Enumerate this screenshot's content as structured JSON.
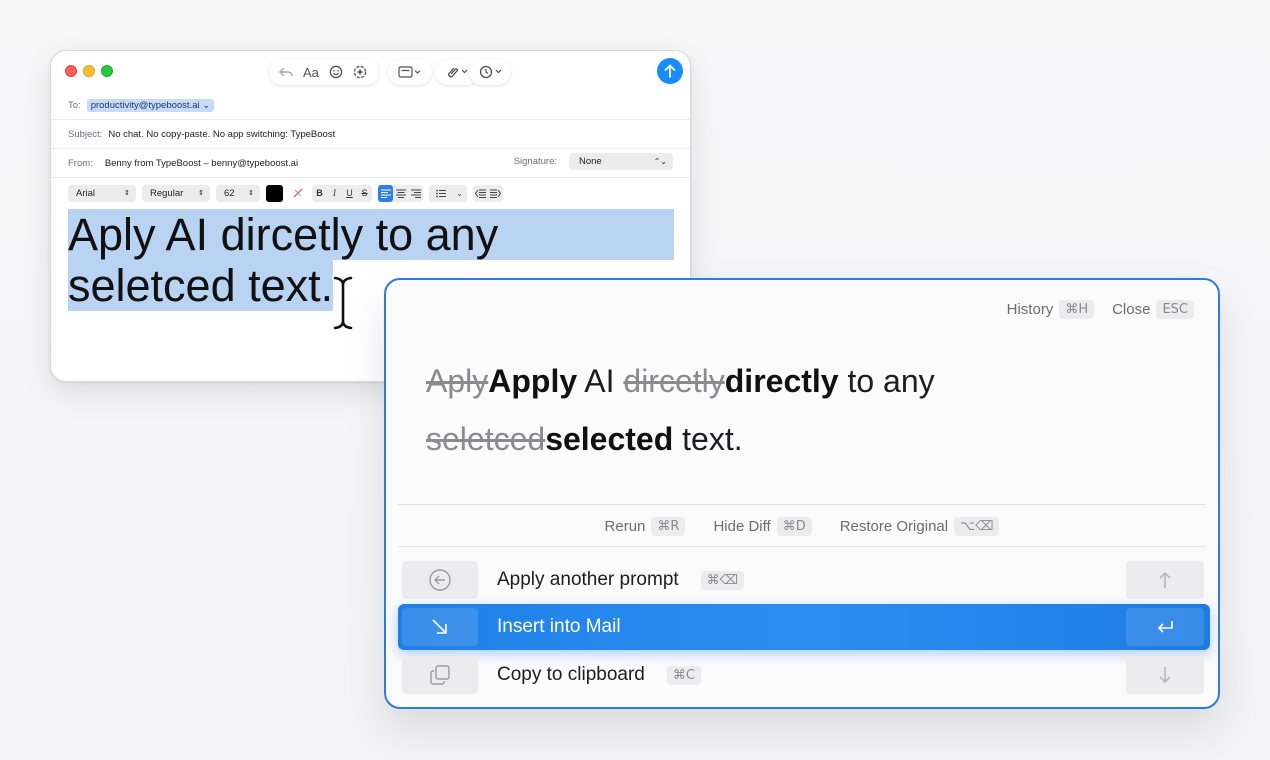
{
  "mail": {
    "to_label": "To:",
    "to_value": "productivity@typeboost.ai",
    "subject_label": "Subject:",
    "subject_value": "No chat. No copy-paste. No app switching: TypeBoost",
    "from_label": "From:",
    "from_value": "Benny from TypeBoost – benny@typeboost.ai",
    "signature_label": "Signature:",
    "signature_value": "None",
    "toolbar": {
      "font_button": "Aa"
    },
    "format": {
      "font": "Arial",
      "style": "Regular",
      "size": "62",
      "bold": "B",
      "italic": "I",
      "underline": "U",
      "strike": "S"
    },
    "body_line1": "Aply AI dircetly to any",
    "body_line2": "seletced text."
  },
  "panel": {
    "history_label": "History",
    "history_key": "⌘H",
    "close_label": "Close",
    "close_key": "ESC",
    "diff": {
      "del1": "Aply",
      "ins1": "Apply",
      "plain1": " AI ",
      "del2": "dircetly",
      "ins2": "directly",
      "plain2": " to any",
      "del3": "seletced",
      "ins3": "selected",
      "plain3": " text."
    },
    "rerun_label": "Rerun",
    "rerun_key": "⌘R",
    "hide_diff_label": "Hide Diff",
    "hide_diff_key": "⌘D",
    "restore_label": "Restore Original",
    "restore_key": "⌥⌫",
    "options": [
      {
        "label": "Apply another prompt",
        "key": "⌘⌫"
      },
      {
        "label": "Insert into Mail",
        "key": ""
      },
      {
        "label": "Copy to clipboard",
        "key": "⌘C"
      }
    ]
  },
  "colors": {
    "accent": "#2d7ce0",
    "selection": "#b9d3f3",
    "send": "#1a8cff"
  }
}
